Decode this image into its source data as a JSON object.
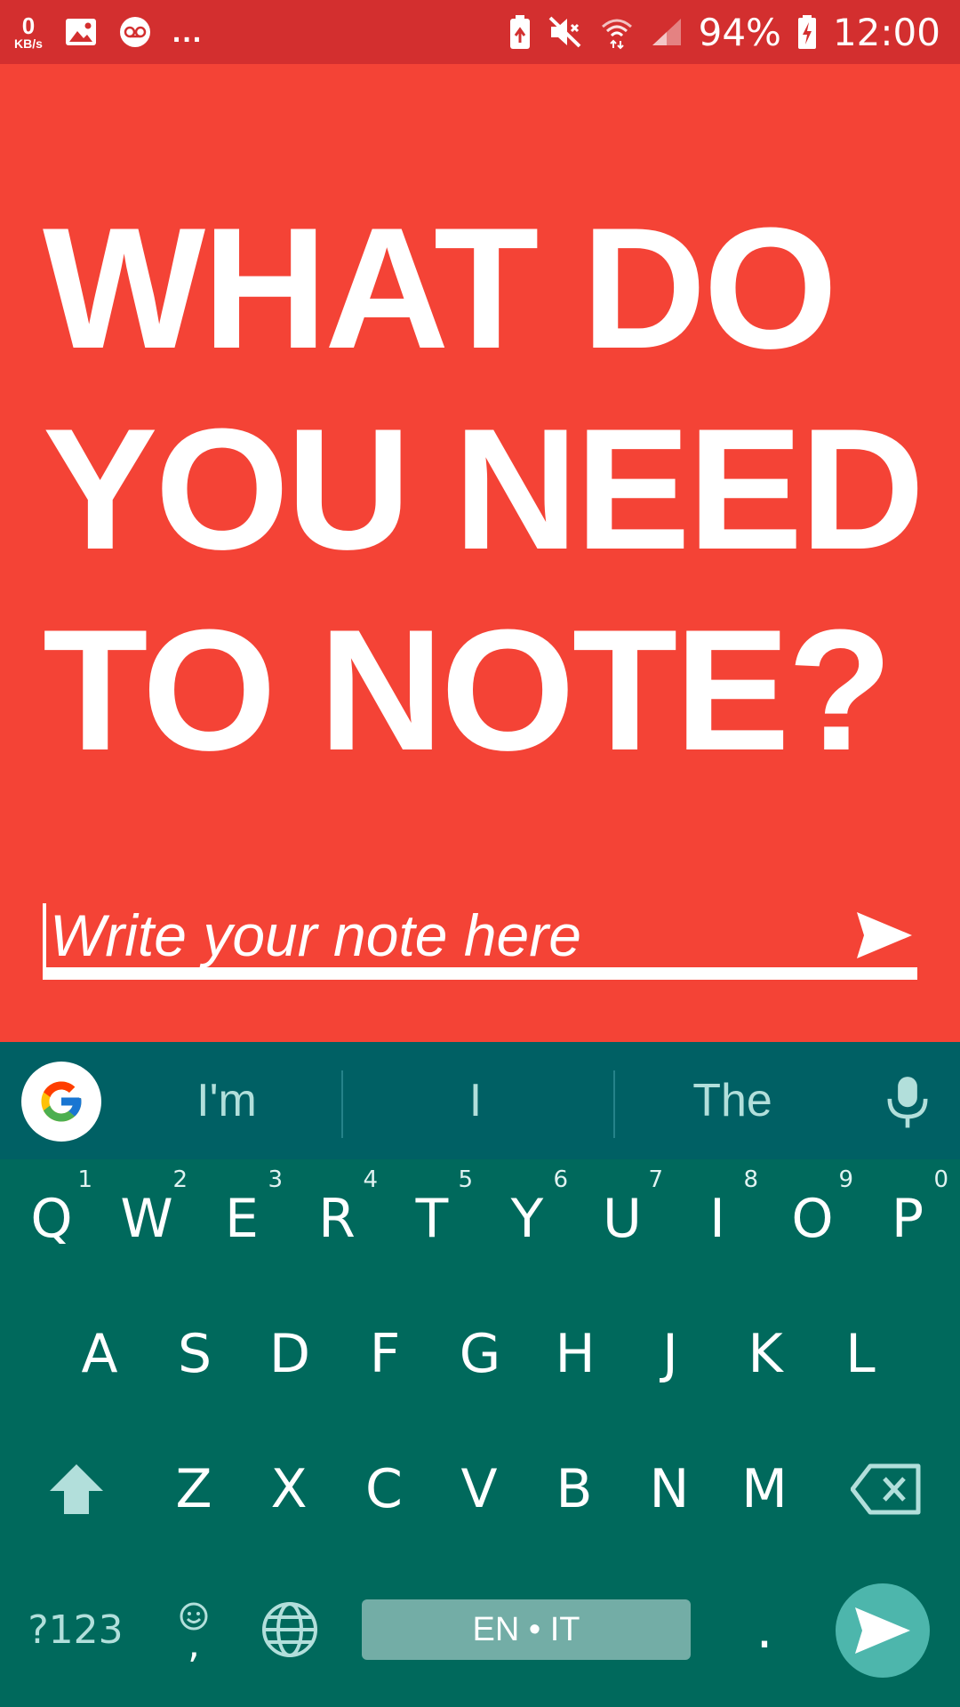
{
  "status_bar": {
    "net_speed_value": "0",
    "net_speed_unit": "KB/s",
    "more_indicator": "...",
    "battery_percent": "94%",
    "time": "12:00"
  },
  "main": {
    "headline": "WHAT DO YOU NEED TO NOTE?",
    "note_placeholder": "Write your note here",
    "note_value": ""
  },
  "keyboard": {
    "suggestions": [
      "I'm",
      "I",
      "The"
    ],
    "row1": [
      {
        "k": "Q",
        "h": "1"
      },
      {
        "k": "W",
        "h": "2"
      },
      {
        "k": "E",
        "h": "3"
      },
      {
        "k": "R",
        "h": "4"
      },
      {
        "k": "T",
        "h": "5"
      },
      {
        "k": "Y",
        "h": "6"
      },
      {
        "k": "U",
        "h": "7"
      },
      {
        "k": "I",
        "h": "8"
      },
      {
        "k": "O",
        "h": "9"
      },
      {
        "k": "P",
        "h": "0"
      }
    ],
    "row2": [
      "A",
      "S",
      "D",
      "F",
      "G",
      "H",
      "J",
      "K",
      "L"
    ],
    "row3": [
      "Z",
      "X",
      "C",
      "V",
      "B",
      "N",
      "M"
    ],
    "symbols_key": "?123",
    "comma_key": ",",
    "space_label": "EN • IT",
    "period_key": "."
  },
  "colors": {
    "accent": "#F44336",
    "status_bar": "#D32F2F",
    "keyboard_bg": "#00695C",
    "suggestion_bar": "#006064",
    "enter_key": "#4DB6AC"
  },
  "icons": [
    "image-icon",
    "voicemail-icon",
    "battery-saver-icon",
    "mute-icon",
    "wifi-icon",
    "cell-signal-icon",
    "battery-charging-icon",
    "send-icon",
    "google-icon",
    "mic-icon",
    "shift-icon",
    "backspace-icon",
    "emoji-icon",
    "globe-icon",
    "enter-send-icon"
  ]
}
